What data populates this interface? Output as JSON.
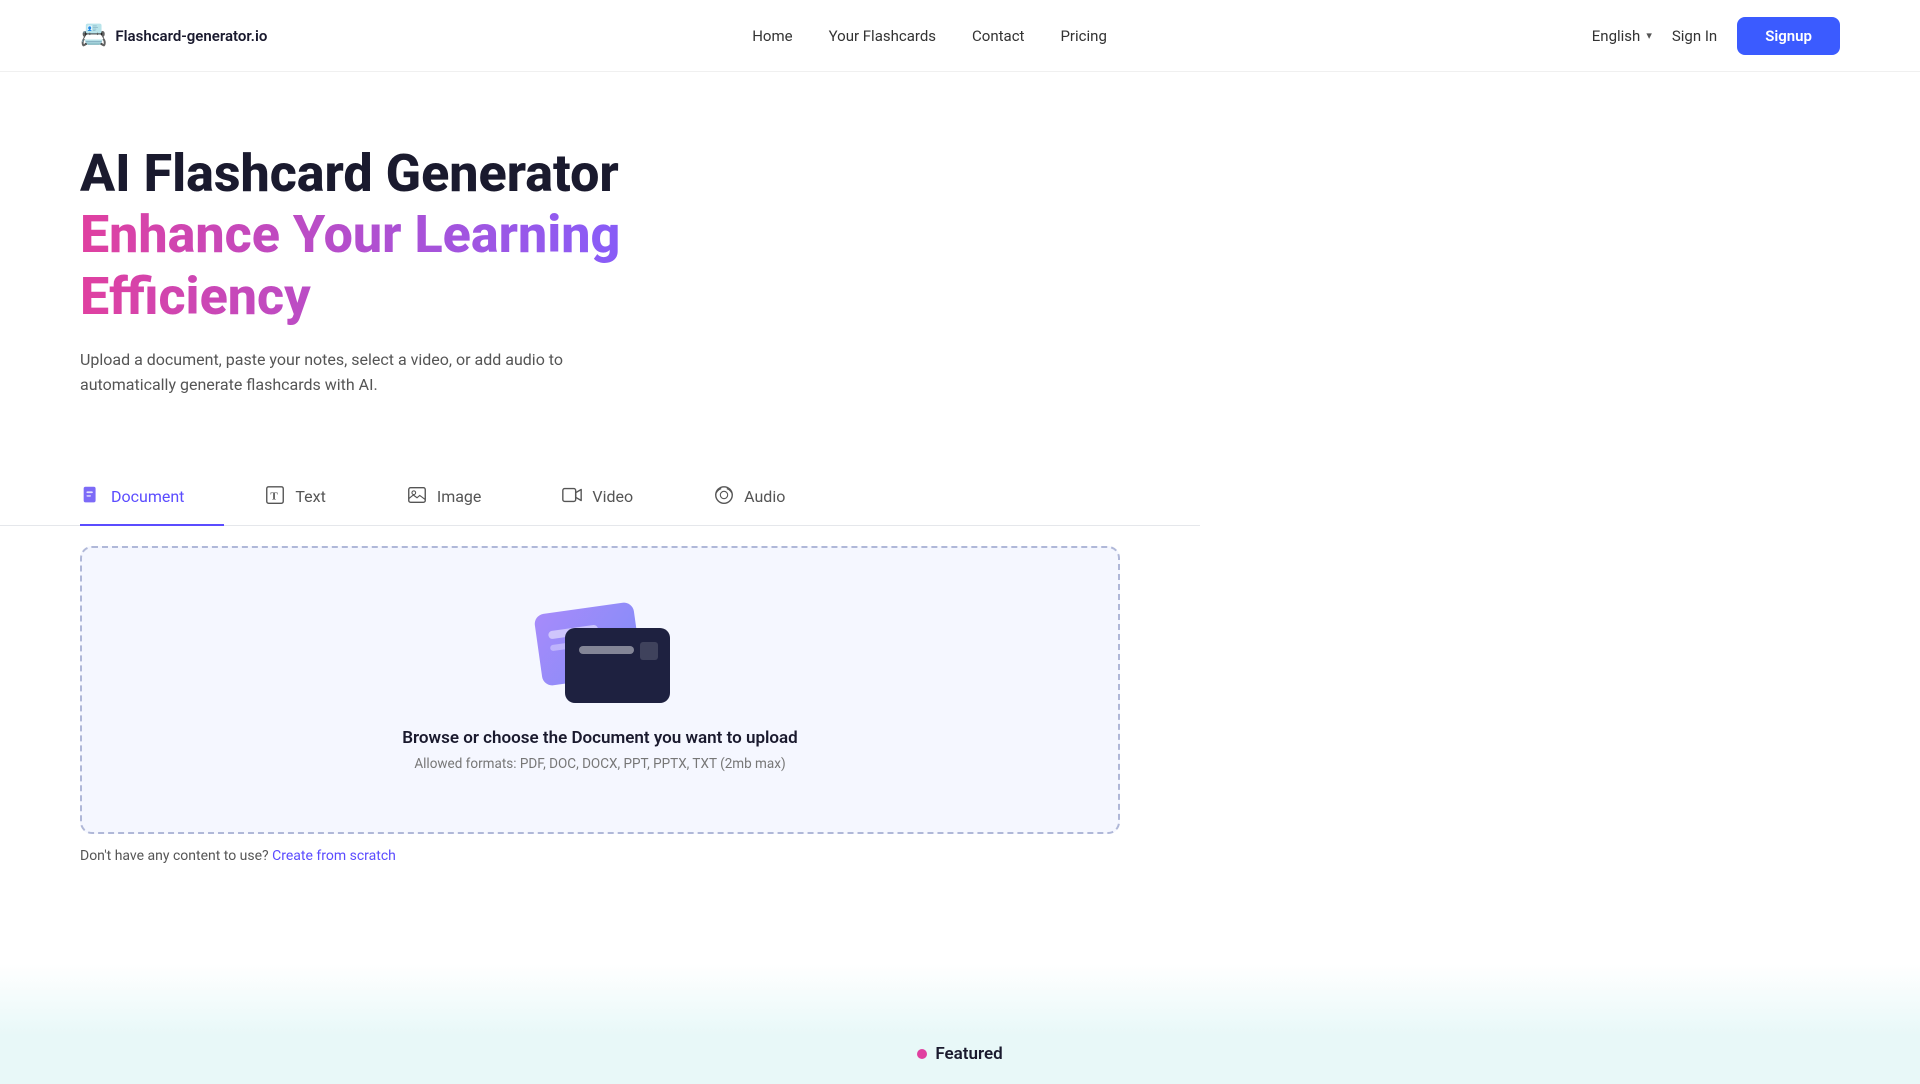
{
  "navbar": {
    "logo_icon": "📇",
    "logo_text": "Flashcard-generator.io",
    "nav_links": [
      {
        "id": "home",
        "label": "Home"
      },
      {
        "id": "your-flashcards",
        "label": "Your Flashcards"
      },
      {
        "id": "contact",
        "label": "Contact"
      },
      {
        "id": "pricing",
        "label": "Pricing"
      }
    ],
    "language": "English",
    "signin_label": "Sign In",
    "signup_label": "Signup"
  },
  "hero": {
    "title_black": "AI Flashcard Generator",
    "title_gradient_line1": "Enhance Your Learning",
    "title_gradient_line2": "Efficiency",
    "description": "Upload a document, paste your notes, select a video, or add audio to automatically generate flashcards with AI."
  },
  "tabs": [
    {
      "id": "document",
      "label": "Document",
      "icon": "📂",
      "active": true
    },
    {
      "id": "text",
      "label": "Text",
      "icon": "T",
      "active": false
    },
    {
      "id": "image",
      "label": "Image",
      "icon": "🖼",
      "active": false
    },
    {
      "id": "video",
      "label": "Video",
      "icon": "📽",
      "active": false
    },
    {
      "id": "audio",
      "label": "Audio",
      "icon": "🔊",
      "active": false
    }
  ],
  "upload": {
    "title": "Browse or choose the Document you want to upload",
    "subtitle": "Allowed formats: PDF, DOC, DOCX, PPT, PPTX, TXT (2mb max)"
  },
  "scratch": {
    "text": "Don't have any content to use?",
    "link_label": "Create from scratch"
  },
  "featured": {
    "label": "Featured"
  }
}
